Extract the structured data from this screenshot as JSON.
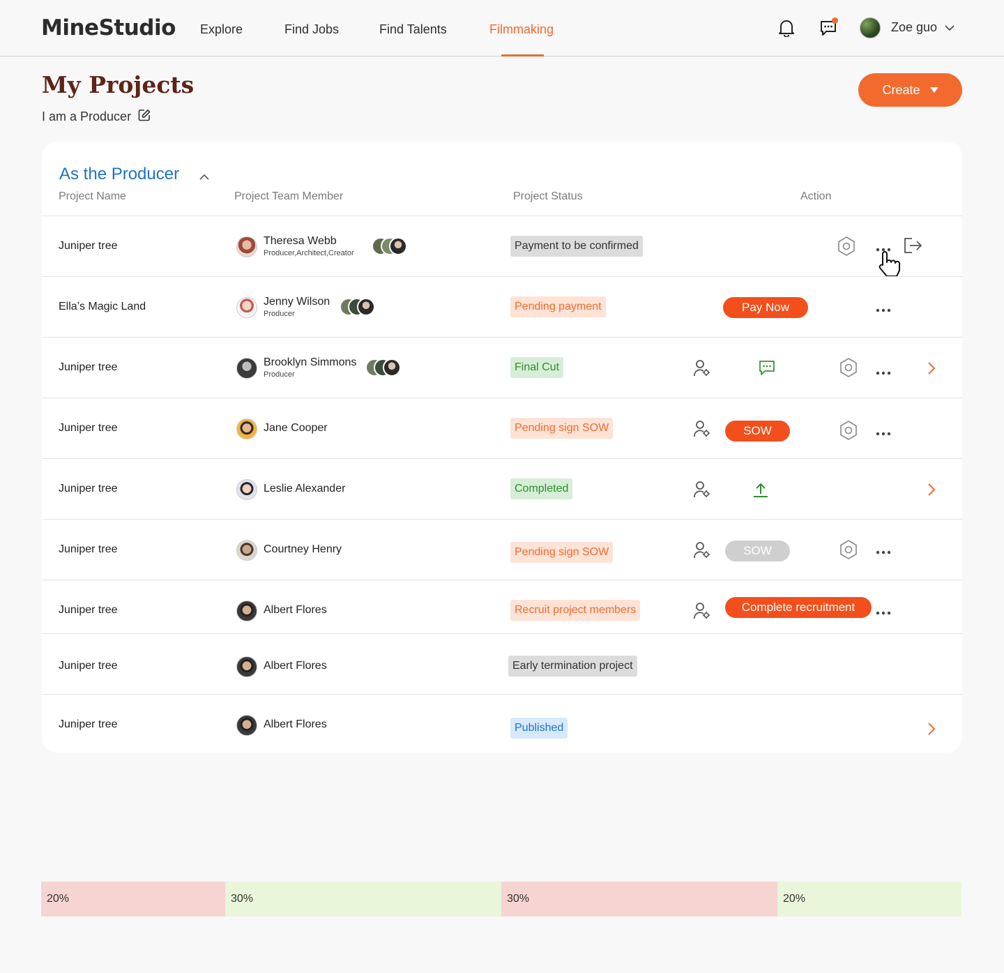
{
  "header": {
    "logo": "MineStudio",
    "nav": [
      {
        "label": "Explore",
        "active": false
      },
      {
        "label": "Find Jobs",
        "active": false
      },
      {
        "label": "Find Talents",
        "active": false
      },
      {
        "label": "Filmmaking",
        "active": true
      }
    ],
    "user_name": "Zoe guo",
    "icons": [
      "bell-icon",
      "chat-icon",
      "chevron-down-icon"
    ]
  },
  "page": {
    "title": "My Projects",
    "role": "I am a Producer",
    "create_label": "Create"
  },
  "section": {
    "title": "As the Producer",
    "columns": [
      "Project Name",
      "Project Team Member",
      "Project Status",
      "Action"
    ]
  },
  "rows": [
    {
      "project": "Juniper tree",
      "member": "Theresa Webb",
      "role": "Producer,Architect,Creator",
      "status": "Payment to be confirmed",
      "status_color": "gray",
      "actions": [
        "settings-hex-icon",
        "more-icon",
        "exit-icon"
      ]
    },
    {
      "project": "Ella’s Magic Land",
      "member": "Jenny Wilson",
      "role": "Producer",
      "status": "Pending payment",
      "status_color": "orange",
      "button": "Pay Now",
      "actions": [
        "more-icon"
      ]
    },
    {
      "project": "Juniper tree",
      "member": "Brooklyn Simmons",
      "role": "Producer",
      "status": "Final Cut",
      "status_color": "green",
      "actions": [
        "user-settings-icon",
        "message-icon",
        "settings-hex-icon",
        "more-icon",
        "chevron-right-icon"
      ]
    },
    {
      "project": "Juniper tree",
      "member": "Jane Cooper",
      "role": "",
      "status": "Pending sign SOW",
      "status_color": "orange",
      "button": "SOW",
      "actions": [
        "user-settings-icon",
        "settings-hex-icon",
        "more-icon"
      ]
    },
    {
      "project": "Juniper tree",
      "member": "Leslie Alexander",
      "role": "",
      "status": "Completed",
      "status_color": "green",
      "actions": [
        "user-settings-icon",
        "upload-icon",
        "chevron-right-icon"
      ]
    },
    {
      "project": "Juniper tree",
      "member": "Courtney Henry",
      "role": "",
      "status": "Pending sign SOW",
      "status_color": "orange",
      "button": "SOW",
      "button_disabled": true,
      "actions": [
        "user-settings-icon",
        "settings-hex-icon",
        "more-icon"
      ]
    },
    {
      "project": "Juniper tree",
      "member": "Albert Flores",
      "role": "",
      "status": "Recruit project members",
      "status_color": "orange",
      "button": "Complete recruitment",
      "actions": [
        "user-settings-icon",
        "more-icon"
      ]
    },
    {
      "project": "Juniper tree",
      "member": "Albert Flores",
      "role": "",
      "status": "Early termination project",
      "status_color": "gray",
      "actions": []
    },
    {
      "project": "Juniper tree",
      "member": "Albert Flores",
      "role": "",
      "status": "Published",
      "status_color": "blue",
      "actions": [
        "chevron-right-icon"
      ]
    }
  ],
  "column_widths": [
    {
      "label": "20%",
      "fraction": 0.2,
      "color": "#f6d4d2"
    },
    {
      "label": "30%",
      "fraction": 0.3,
      "color": "#eaf6da"
    },
    {
      "label": "30%",
      "fraction": 0.3,
      "color": "#f6d4d2"
    },
    {
      "label": "20%",
      "fraction": 0.2,
      "color": "#eaf6da"
    }
  ],
  "colors": {
    "accent": "#f26a2e",
    "link_blue": "#1f72c9",
    "title_brown": "#5c2418"
  }
}
